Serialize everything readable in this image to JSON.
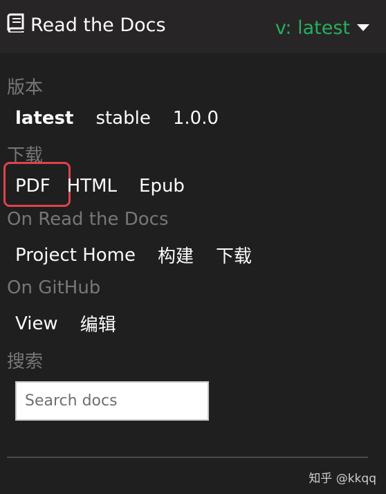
{
  "header": {
    "brand_label": "Read the Docs",
    "version_label": "v: latest",
    "brand_icon": "book-icon",
    "caret_icon": "caret-down-icon",
    "version_color": "#27ae60"
  },
  "versions": {
    "title": "版本",
    "items": [
      "latest",
      "stable",
      "1.0.0"
    ]
  },
  "downloads": {
    "title": "下载",
    "items": [
      "PDF",
      "HTML",
      "Epub"
    ]
  },
  "on_rtd": {
    "title": "On Read the Docs",
    "items": [
      "Project Home",
      "构建",
      "下载"
    ]
  },
  "on_github": {
    "title": "On GitHub",
    "items": [
      "View",
      "编辑"
    ]
  },
  "search": {
    "title": "搜索",
    "placeholder": "Search docs"
  },
  "watermark": "知乎 @kkqq",
  "highlight_color": "#e0434b"
}
